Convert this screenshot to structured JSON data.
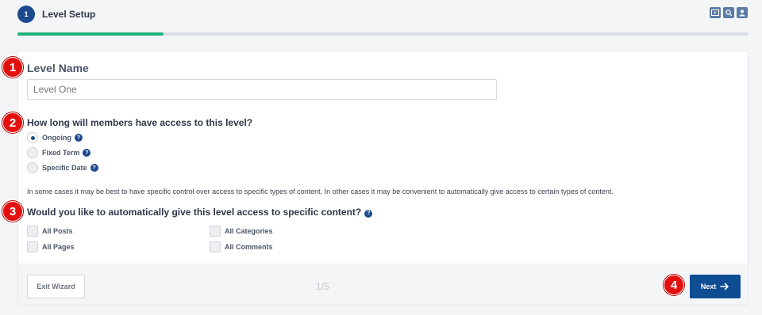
{
  "header": {
    "step_number": "1",
    "step_title": "Level Setup",
    "icons": [
      "video-tutorial-icon",
      "search-docs-icon",
      "user-account-icon"
    ],
    "progress_fraction": 0.2
  },
  "level_name": {
    "label": "Level Name",
    "value": "",
    "placeholder": "Level One"
  },
  "access_duration": {
    "question": "How long will members have access to this level?",
    "options": [
      {
        "label": "Ongoing",
        "checked": true
      },
      {
        "label": "Fixed Term",
        "checked": false
      },
      {
        "label": "Specific Date",
        "checked": false
      }
    ]
  },
  "info_text": "In some cases it may be best to have specific control over access to specific types of content. In other cases it may be convenient to automatically give access to certain types of content.",
  "content_access": {
    "question": "Would you like to automatically give this level access to specific content?",
    "options": [
      {
        "label": "All Posts",
        "checked": false
      },
      {
        "label": "All Pages",
        "checked": false
      },
      {
        "label": "All Categories",
        "checked": false
      },
      {
        "label": "All Comments",
        "checked": false
      }
    ]
  },
  "footer": {
    "exit_label": "Exit Wizard",
    "step_count": "1/5",
    "next_label": "Next"
  },
  "markers": [
    "1",
    "2",
    "3",
    "4"
  ],
  "colors": {
    "primary": "#0e4d92",
    "progress": "#1fb47a",
    "marker": "#e31010"
  }
}
